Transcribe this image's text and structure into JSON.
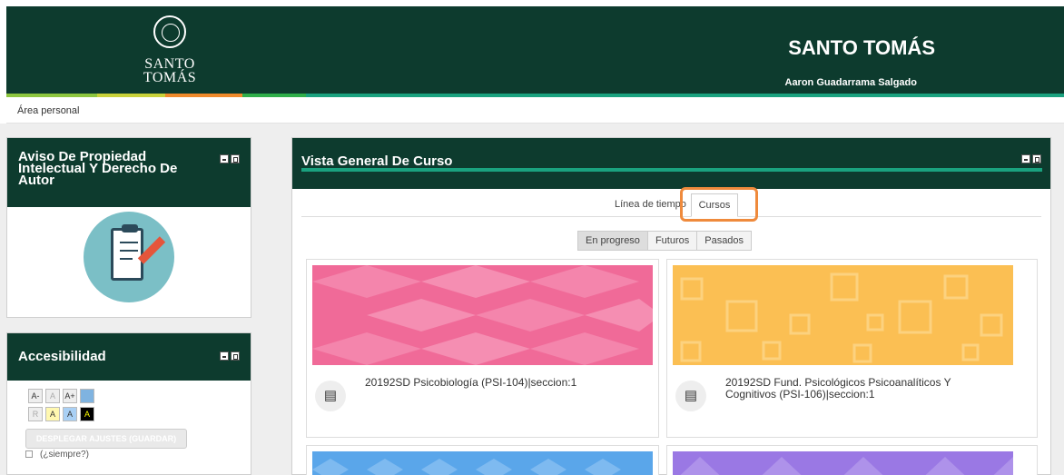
{
  "header": {
    "logo_line1": "SANTO",
    "logo_line2": "TOMÁS",
    "brand": "SANTO TOMÁS",
    "user": "Aaron Guadarrama Salgado",
    "colors": {
      "primary": "#0d3b2e",
      "accent": "#1aa27f",
      "highlight": "#ef8a3c"
    }
  },
  "breadcrumb": {
    "label": "Área personal"
  },
  "blocks": {
    "aviso": {
      "title_line1": "Aviso De Propiedad",
      "title_line2": "Intelectual Y Derecho De",
      "title_line3": "Autor",
      "icon": "clipboard-pencil-icon"
    },
    "accesibilidad": {
      "title": "Accesibilidad",
      "buttons": [
        "A-",
        "A",
        "A+",
        "R",
        "A",
        "A",
        "A"
      ],
      "save": "DESPLEGAR AJUSTES (GUARDAR)",
      "always": "(¿siempre?)"
    }
  },
  "main": {
    "title": "Vista General De Curso",
    "tabs": {
      "timeline": "Línea de tiempo",
      "courses": "Cursos"
    },
    "filters": {
      "inprogress": "En progreso",
      "future": "Futuros",
      "past": "Pasados"
    },
    "courses": [
      {
        "name": "20192SD Psicobiología (PSI-104)|seccion:1",
        "color": "#f06a98"
      },
      {
        "line1": "20192SD Fund. Psicológicos Psicoanalíticos Y",
        "line2": "Cognitivos (PSI-106)|seccion:1",
        "color": "#fbbf53"
      },
      {
        "color": "#5aa6ea"
      },
      {
        "color": "#9a78e4"
      }
    ]
  }
}
